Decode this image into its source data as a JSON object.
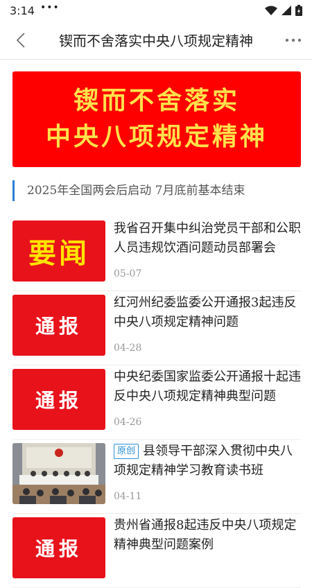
{
  "status_bar": {
    "time": "3:14",
    "dots": "•••"
  },
  "nav": {
    "title": "锲而不舍落实中央八项规定精神"
  },
  "banner": {
    "line1": "锲而不舍落实",
    "line2": "中央八项规定精神"
  },
  "subtitle": "2025年全国两会后启动  7月底前基本结束",
  "news": [
    {
      "thumb_text": "要闻",
      "thumb_style": "yellow",
      "tag": "",
      "title": "我省召开集中纠治党员干部和公职人员违规饮酒问题动员部署会",
      "date": "05-07"
    },
    {
      "thumb_text": "通报",
      "thumb_style": "white",
      "tag": "",
      "title": "红河州纪委监委公开通报3起违反中央八项规定精神问题",
      "date": "04-28"
    },
    {
      "thumb_text": "通报",
      "thumb_style": "white",
      "tag": "",
      "title": "中央纪委国家监委公开通报十起违反中央八项规定精神典型问题",
      "date": "04-26"
    },
    {
      "thumb_text": "",
      "thumb_style": "photo",
      "tag": "原创",
      "title": "县领导干部深入贯彻中央八项规定精神学习教育读书班",
      "date": "04-11"
    },
    {
      "thumb_text": "通报",
      "thumb_style": "white",
      "tag": "",
      "title": "贵州省通报8起违反中央八项规定精神典型问题案例",
      "date": ""
    }
  ],
  "colors": {
    "banner_red": "#ff0000",
    "banner_text": "#ffe14a",
    "thumb_red": "#e8121b",
    "accent_blue": "#2b7bd4"
  }
}
